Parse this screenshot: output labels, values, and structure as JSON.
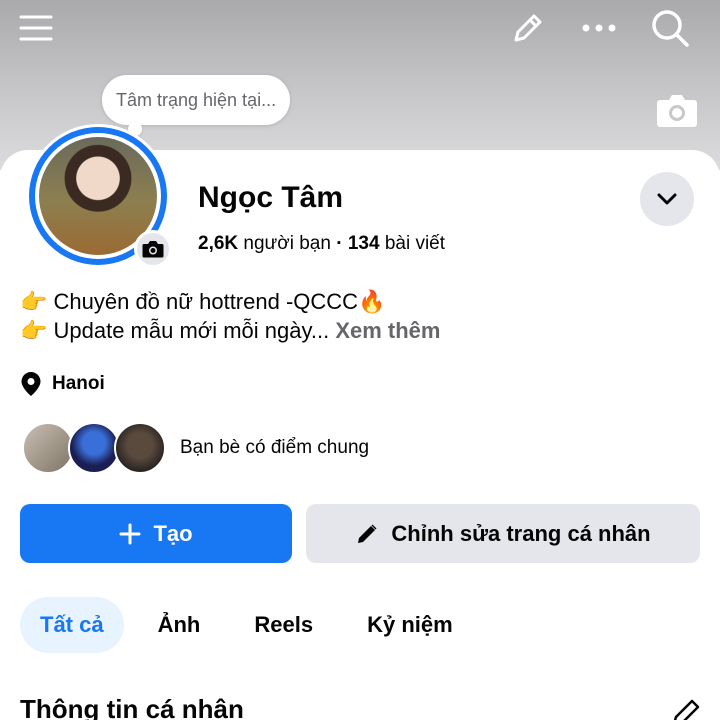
{
  "topbar": {
    "icons": [
      "menu-icon",
      "edit-icon",
      "more-icon",
      "search-icon"
    ]
  },
  "profile": {
    "mood_placeholder": "Tâm trạng hiện tại...",
    "name": "Ngọc Tâm",
    "friends_count": "2,6K",
    "friends_label": "người bạn",
    "separator": "·",
    "posts_count": "134",
    "posts_label": "bài viết"
  },
  "bio": {
    "line1": "👉 Chuyên đồ nữ hottrend -QCCC🔥",
    "line2": "👉 Update mẫu mới mỗi ngày...",
    "see_more": "Xem thêm"
  },
  "location": "Hanoi",
  "mutual_friends": {
    "label": "Bạn bè có điểm chung"
  },
  "buttons": {
    "create": "Tạo",
    "edit_profile": "Chỉnh sửa trang cá nhân"
  },
  "tabs": [
    {
      "label": "Tất cả",
      "active": true
    },
    {
      "label": "Ảnh",
      "active": false
    },
    {
      "label": "Reels",
      "active": false
    },
    {
      "label": "Kỷ niệm",
      "active": false
    }
  ],
  "section": {
    "title": "Thông tin cá nhân"
  },
  "colors": {
    "accent": "#1877f2",
    "secondary_button": "#e4e6eb",
    "active_tab_bg": "#e7f3ff",
    "muted_text": "#65676b"
  }
}
